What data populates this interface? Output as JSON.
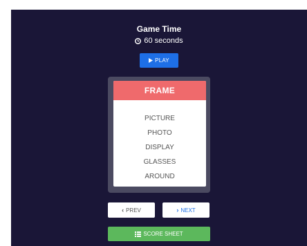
{
  "game": {
    "title": "Game Time",
    "time_text": "60 seconds",
    "time_icon": "clock-icon"
  },
  "controls": {
    "play_label": "PLAY",
    "play_icon": "play-icon",
    "prev_label": "PREV",
    "prev_icon": "chevron-left-icon",
    "next_label": "NEXT",
    "next_icon": "chevron-right-icon",
    "score_label": "SCORE SHEET",
    "score_icon": "table-icon"
  },
  "card": {
    "target_word": "FRAME",
    "taboo_words": [
      "PICTURE",
      "PHOTO",
      "DISPLAY",
      "GLASSES",
      "AROUND"
    ]
  },
  "colors": {
    "background": "#1a1637",
    "play_button": "#1e6fe6",
    "card_header": "#ef6a6c",
    "score_button": "#5cb85c"
  }
}
